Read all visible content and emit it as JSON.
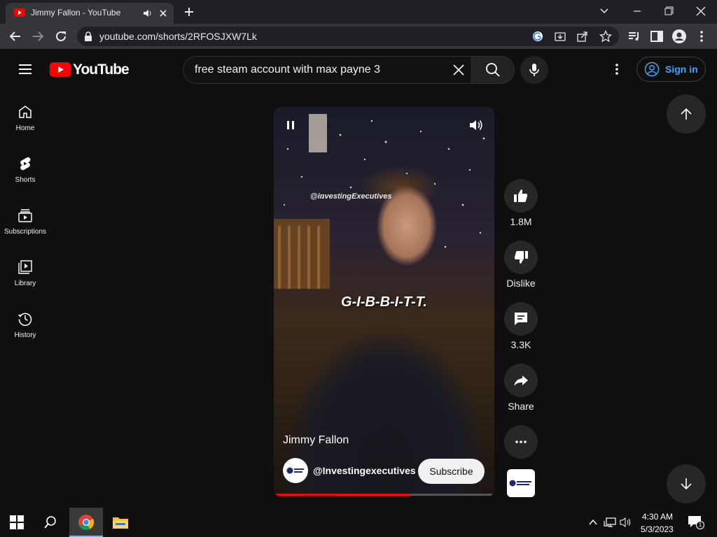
{
  "browser": {
    "tab_title": "Jimmy Fallon - YouTube",
    "url": "youtube.com/shorts/2RFOSJXW7Lk"
  },
  "header": {
    "logo_text": "YouTube",
    "search_value": "free steam account with max payne 3",
    "signin_label": "Sign in"
  },
  "sidebar": {
    "items": [
      {
        "label": "Home",
        "icon": "home-icon"
      },
      {
        "label": "Shorts",
        "icon": "shorts-icon"
      },
      {
        "label": "Subscriptions",
        "icon": "subscriptions-icon"
      },
      {
        "label": "Library",
        "icon": "library-icon"
      },
      {
        "label": "History",
        "icon": "history-icon"
      }
    ]
  },
  "video": {
    "watermark": "@investingExecutives",
    "caption": "G-I-B-B-I-T-T.",
    "title": "Jimmy Fallon",
    "channel": "@Investingexecutives",
    "subscribe_label": "Subscribe",
    "progress_fraction": 0.62
  },
  "actions": {
    "likes": "1.8M",
    "dislike_label": "Dislike",
    "comments": "3.3K",
    "share_label": "Share"
  },
  "taskbar": {
    "time": "4:30 AM",
    "date": "5/3/2023",
    "notification_count": "1"
  },
  "colors": {
    "youtube_red": "#ff0000",
    "link_blue": "#3ea6ff",
    "page_bg": "#0f0f0f"
  }
}
